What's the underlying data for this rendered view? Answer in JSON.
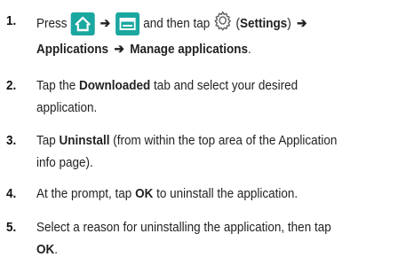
{
  "colors": {
    "icon_teal": "#1aa7a0",
    "text": "#222222"
  },
  "steps": [
    {
      "number": "1.",
      "press": "Press",
      "arrow": "➔",
      "and_then_tap": "and then tap",
      "settings_paren_open": "(",
      "settings": "Settings",
      "settings_paren_close": ")",
      "applications": "Applications",
      "manage_applications": "Manage applications",
      "period": ".",
      "icons": [
        "home-icon",
        "menu-icon",
        "settings-gear-icon"
      ]
    },
    {
      "number": "2.",
      "line1_pre": "Tap the",
      "line1_bold": "Downloaded",
      "line1_post": "tab and select your desired",
      "line2": "application."
    },
    {
      "number": "3.",
      "line1_pre": "Tap",
      "line1_bold": "Uninstall",
      "line1_post": "(from within the top area of the Application",
      "line2": "info page)."
    },
    {
      "number": "4.",
      "pre": "At the prompt, tap",
      "bold": "OK",
      "post": "to uninstall the application."
    },
    {
      "number": "5.",
      "line1": "Select a reason for uninstalling the application, then tap",
      "line2_bold": "OK",
      "line2_post": "."
    }
  ]
}
